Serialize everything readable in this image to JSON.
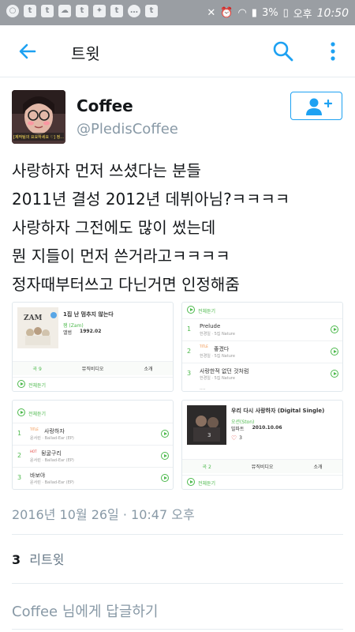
{
  "status_bar": {
    "left_icons": [
      "circle-icon",
      "talk-icon",
      "talk-icon",
      "cloud-icon",
      "talk-icon",
      "twitter-icon",
      "talk-icon",
      "chat-icon",
      "talk-icon"
    ],
    "battery": "3%",
    "ampm": "오후",
    "time": "10:50"
  },
  "app_bar": {
    "title": "트윗"
  },
  "tweet": {
    "name": "Coffee",
    "handle": "@PledisCoffee",
    "text_lines": [
      "사랑하자 먼저 쓰셨다는 분들",
      "2011년 결성 2012년 데뷔아님?ㅋㅋㅋㅋ",
      "사랑하자 그전에도 많이 썼는데",
      "뭔 지들이 먼저 쓴거라고ㅋㅋㅋㅋ",
      "정자때부터쓰고 다닌거면 인정해줌"
    ],
    "avatar_caption": "[제작팀의 요요하세요 ♡] 정..."
  },
  "media": {
    "m1": {
      "album_title": "1집 난 멈추지 않는다",
      "artist": "잼 (Zam)",
      "type": "앨범",
      "date": "1992.02",
      "badge": "ZAM",
      "tabs": [
        "곡 9",
        "뮤직비디오",
        "소개"
      ],
      "listen_all": "전체듣기"
    },
    "m2": {
      "listen_all": "전체듣기",
      "tracks": [
        {
          "num": "1",
          "title": "Prelude",
          "sub": "한경일 · 5집 Nature",
          "badge": ""
        },
        {
          "num": "2",
          "title": "좋겠다",
          "sub": "한경일 · 5집 Nature",
          "badge": "TITLE"
        },
        {
          "num": "3",
          "title": "사랑한적 없던 것처럼",
          "sub": "한경일 · 5집 Nature",
          "badge": ""
        }
      ],
      "cut_off": "...."
    },
    "m3": {
      "listen_all": "전체듣기",
      "tracks": [
        {
          "num": "1",
          "title": "사랑하자",
          "sub": "윤서린 · Ballad-Ear (EP)",
          "badge": "TITLE"
        },
        {
          "num": "2",
          "title": "뒹굴구리",
          "sub": "윤서린 · Ballad-Ear (EP)",
          "badge": "HOT"
        },
        {
          "num": "3",
          "title": "바보야",
          "sub": "윤서린 · Ballad-Ear (EP)",
          "badge": ""
        }
      ]
    },
    "m4": {
      "album_title": "우리 다시 사랑하자 (Digital Single)",
      "artist": "오션(Ston)",
      "type": "빌파트",
      "date": "2010.10.06",
      "likes": "3",
      "tabs": [
        "곡 2",
        "뮤직비디오",
        "소개"
      ],
      "listen_all": "전체듣기"
    }
  },
  "timestamp": "2016년 10월 26일 · 10:47 오후",
  "retweets": {
    "count": "3",
    "label": "리트윗"
  },
  "reply": {
    "placeholder": "Coffee 님에게 답글하기"
  },
  "colors": {
    "twitter_blue": "#1da1f2",
    "status_bar": "#9a9ea3",
    "melon_green": "#4cb94c",
    "secondary_text": "#8899a6"
  }
}
